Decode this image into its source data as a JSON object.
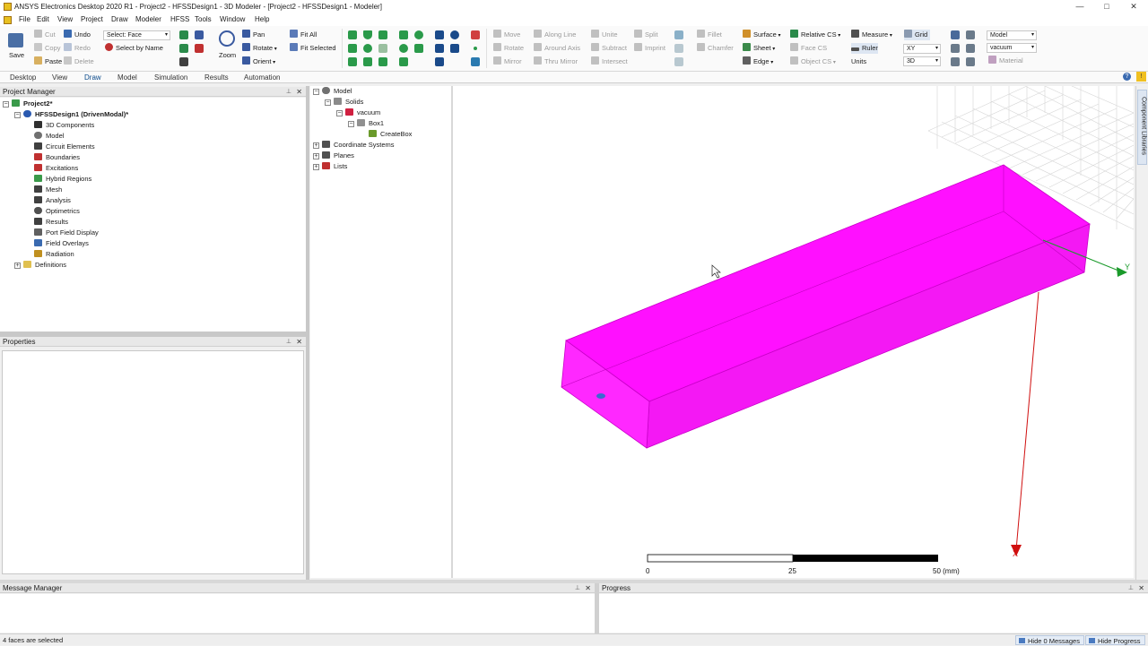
{
  "window": {
    "title": "ANSYS Electronics Desktop 2020 R1 - Project2 - HFSSDesign1 - 3D Modeler - [Project2 - HFSSDesign1 - Modeler]",
    "min": "—",
    "max": "□",
    "close": "✕"
  },
  "menu": [
    "File",
    "Edit",
    "View",
    "Project",
    "Draw",
    "Modeler",
    "HFSS",
    "Tools",
    "Window",
    "Help"
  ],
  "ribbon": {
    "save": "Save",
    "cut": "Cut",
    "copy": "Copy",
    "paste": "Paste",
    "undo": "Undo",
    "redo": "Redo",
    "delete": "Delete",
    "select_label": "Select: Face",
    "select_by_name": "Select by Name",
    "zoom": "Zoom",
    "pan": "Pan",
    "rotate": "Rotate",
    "orient": "Orient",
    "fit_all": "Fit All",
    "fit_selected": "Fit Selected",
    "move": "Move",
    "rotate2": "Rotate",
    "mirror": "Mirror",
    "along_line": "Along Line",
    "around_axis": "Around Axis",
    "thru_mirror": "Thru Mirror",
    "unite": "Unite",
    "subtract": "Subtract",
    "intersect": "Intersect",
    "split": "Split",
    "imprint": "Imprint",
    "fillet": "Fillet",
    "chamfer": "Chamfer",
    "surface": "Surface",
    "sheet": "Sheet",
    "edge": "Edge",
    "relative_cs": "Relative CS",
    "face_cs": "Face CS",
    "object_cs": "Object CS",
    "measure": "Measure",
    "ruler": "Ruler",
    "units": "Units",
    "grid": "Grid",
    "plane": "XY",
    "dim": "3D",
    "model": "Model",
    "material_value": "vacuum",
    "material": "Material"
  },
  "tabs": [
    "Desktop",
    "View",
    "Draw",
    "Model",
    "Simulation",
    "Results",
    "Automation"
  ],
  "project_manager": {
    "title": "Project Manager",
    "project": "Project2*",
    "design": "HFSSDesign1 (DrivenModal)*",
    "items": [
      "3D Components",
      "Model",
      "Circuit Elements",
      "Boundaries",
      "Excitations",
      "Hybrid Regions",
      "Mesh",
      "Analysis",
      "Optimetrics",
      "Results",
      "Port Field Display",
      "Field Overlays",
      "Radiation"
    ],
    "definitions": "Definitions"
  },
  "properties": {
    "title": "Properties"
  },
  "model_tree": {
    "root": "Model",
    "solids": "Solids",
    "vacuum": "vacuum",
    "box": "Box1",
    "create_box": "CreateBox",
    "coord": "Coordinate Systems",
    "planes": "Planes",
    "lists": "Lists"
  },
  "viewport": {
    "scale_labels": [
      "0",
      "25",
      "50 (mm)"
    ],
    "axis_x": "X",
    "axis_y": "Y",
    "box_color": "#ff10ff"
  },
  "message_manager": {
    "title": "Message Manager"
  },
  "progress": {
    "title": "Progress"
  },
  "status": {
    "text": "4 faces are selected",
    "hide_messages": "Hide 0 Messages",
    "hide_progress": "Hide Progress"
  },
  "side_tab": "Component Libraries"
}
